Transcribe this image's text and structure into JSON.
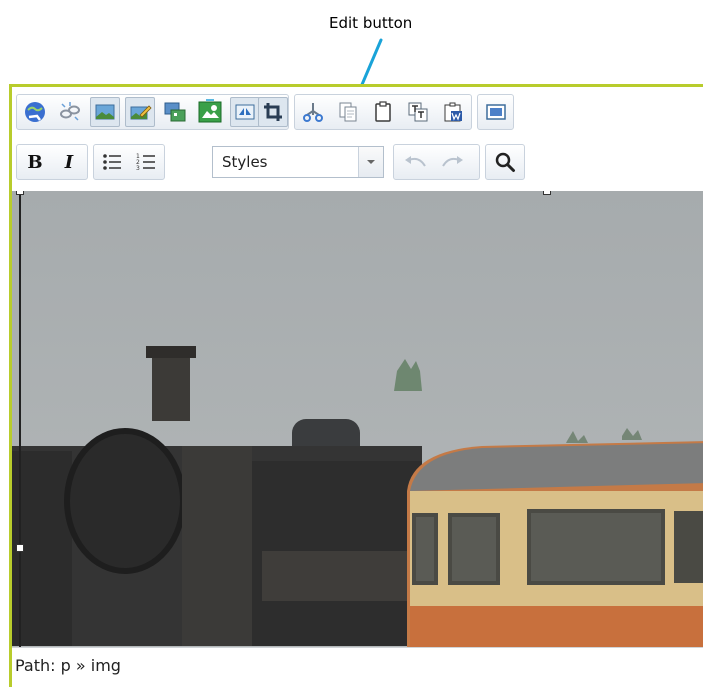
{
  "annotation": {
    "label": "Edit button"
  },
  "toolbar": {
    "row1": [
      {
        "name": "insert-link-icon",
        "active": false
      },
      {
        "name": "unlink-icon",
        "active": false
      },
      {
        "name": "insert-image-icon",
        "active": true
      },
      {
        "name": "edit-image-icon",
        "active": true
      },
      {
        "name": "media-icon",
        "active": false
      },
      {
        "name": "image-manager-icon",
        "active": false
      },
      {
        "name": "flip-image-icon",
        "active": true
      },
      {
        "name": "crop-edit-icon",
        "active": true
      },
      {
        "name": "cut-icon",
        "active": false
      },
      {
        "name": "copy-icon",
        "active": false
      },
      {
        "name": "paste-icon",
        "active": false
      },
      {
        "name": "paste-text-icon",
        "active": false
      },
      {
        "name": "paste-word-icon",
        "active": false
      },
      {
        "name": "preview-icon",
        "active": false
      }
    ],
    "row2": [
      {
        "name": "bold-icon"
      },
      {
        "name": "italic-icon"
      },
      {
        "name": "bulleted-list-icon"
      },
      {
        "name": "numbered-list-icon"
      },
      {
        "name": "undo-icon",
        "disabled": true
      },
      {
        "name": "redo-icon",
        "disabled": true
      },
      {
        "name": "find-icon"
      }
    ],
    "styles_label": "Styles",
    "bold_glyph": "B",
    "italic_glyph": "I"
  },
  "status": {
    "path": "Path: p » img"
  },
  "colors": {
    "editor_border": "#b8cc2c",
    "annotation_arrow": "#1aa3d8",
    "toolbar_bg": "#e8edf3"
  }
}
